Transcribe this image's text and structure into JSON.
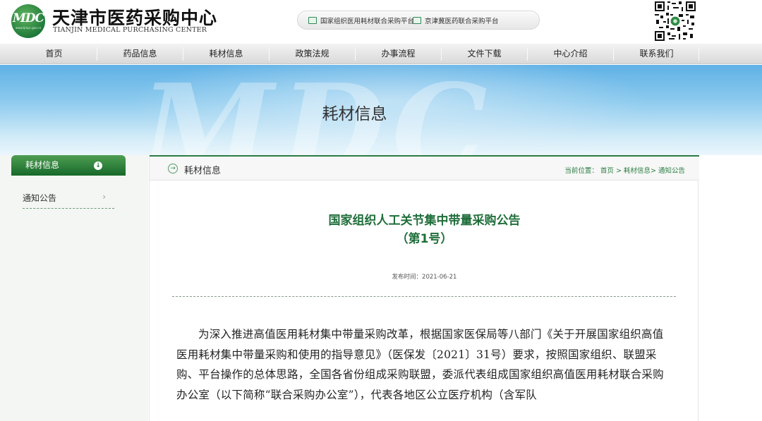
{
  "header": {
    "logo_mark": "MDC",
    "logo_url": "www.tjmpc.gov.cn",
    "site_name_cn": "天津市医药采购中心",
    "site_name_en": "TIANJIN MEDICAL PURCHASING CENTER",
    "platforms": [
      "国家组织医用耗材联合采购平台",
      "京津冀医药联合采购平台"
    ]
  },
  "nav": {
    "items": [
      "首页",
      "药品信息",
      "耗材信息",
      "政策法规",
      "办事流程",
      "文件下载",
      "中心介绍",
      "联系我们"
    ]
  },
  "banner": {
    "watermark": "MDC",
    "title": "耗材信息"
  },
  "sidebar": {
    "heading": "耗材信息",
    "items": [
      {
        "label": "通知公告"
      }
    ]
  },
  "main": {
    "section_title": "耗材信息",
    "breadcrumb": {
      "prefix": "当前位置：",
      "home": "首页",
      "sep1": ">",
      "section": "耗材信息",
      "sep2": ">",
      "current": "通知公告"
    },
    "article": {
      "title_line1": "国家组织人工关节集中带量采购公告",
      "title_line2": "（第1号）",
      "date_label": "发布时间：",
      "date": "2021-06-21",
      "body": "为深入推进高值医用耗材集中带量采购改革，根据国家医保局等八部门《关于开展国家组织高值医用耗材集中带量采购和使用的指导意见》（医保发〔2021〕31号）要求，按照国家组织、联盟采购、平台操作的总体思路，全国各省份组成采购联盟，委派代表组成国家组织高值医用耗材联合采购办公室（以下简称“联合采购办公室”），代表各地区公立医疗机构（含军队"
    }
  },
  "colors": {
    "brand_green": "#1f7a3a",
    "title_green": "#1f6e3a",
    "banner_blue": "#5fb1e6"
  }
}
